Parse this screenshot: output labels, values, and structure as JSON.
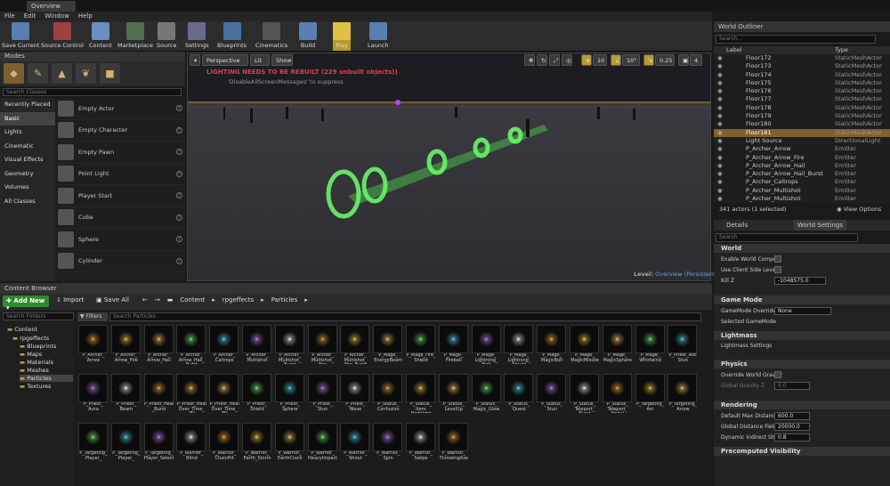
{
  "titlebar": {
    "tab": "Overview"
  },
  "menu": [
    "File",
    "Edit",
    "Window",
    "Help"
  ],
  "toolbar": [
    {
      "label": "Save Current",
      "color": "#5a7fb0"
    },
    {
      "label": "Source Control",
      "color": "#a04040"
    },
    {
      "label": "Content",
      "color": "#6a8fc0"
    },
    {
      "label": "Marketplace",
      "color": "#507050"
    },
    {
      "label": "Source",
      "color": "#777777"
    },
    {
      "label": "Settings",
      "color": "#6a6a8a"
    },
    {
      "label": "Blueprints",
      "color": "#4a6fa0"
    },
    {
      "label": "Cinematics",
      "color": "#555555"
    },
    {
      "label": "Build",
      "color": "#5a7fb0"
    },
    {
      "label": "Play",
      "color": "#e0c040"
    },
    {
      "label": "Launch",
      "color": "#5a7fb0"
    }
  ],
  "modes": {
    "title": "Modes",
    "search_placeholder": "Search Classes",
    "categories": [
      "Recently Placed",
      "Basic",
      "Lights",
      "Cinematic",
      "Visual Effects",
      "Geometry",
      "Volumes",
      "All Classes"
    ],
    "selected_category": "Basic",
    "items": [
      "Empty Actor",
      "Empty Character",
      "Empty Pawn",
      "Point Light",
      "Player Start",
      "Cube",
      "Sphere",
      "Cylinder"
    ]
  },
  "viewport": {
    "perspective": "Perspective",
    "lit": "Lit",
    "show": "Show",
    "grid_snap": "10",
    "rot_snap": "10°",
    "scale_snap": "0.25",
    "cam_speed": "4",
    "warning": "LIGHTING NEEDS TO BE REBUILT (229 unbuilt objects))",
    "suppress": "'DisableAllScreenMessages' to suppress",
    "level_prefix": "Level:",
    "level_name": "Overview (Persistent)"
  },
  "content_browser": {
    "title": "Content Browser",
    "add_new": "Add New",
    "import": "Import",
    "save_all": "Save All",
    "breadcrumb": [
      "Content",
      "rpgeffects",
      "Particles"
    ],
    "folder_search": "Search Folders",
    "filters": "Filters",
    "asset_search": "Search Particles",
    "tree": [
      "Content",
      "rpgeffects",
      "Blueprints",
      "Maps",
      "Materials",
      "Meshes",
      "Particles",
      "Textures"
    ],
    "selected_folder": "Particles",
    "assets": [
      "P_Archer_\nArrow",
      "P_Archer_\nArrow_Fire",
      "P_Archer_\nArrow_Hail",
      "P_Archer_\nArrow_Hail_\nBurst",
      "P_Archer_\nCaltrops",
      "P_Archer_\nMultishot",
      "P_Archer_\nMultishot_\nBurst",
      "P_Archer_\nMultishot_\nFire",
      "P_Archer_\nMultishot_\nFire_Burst",
      "P_Mage_\nEnergyBeam",
      "P_Mage_Fire_\nShield",
      "P_Mage_\nFireball",
      "P_Mage_\nLightning_\nBolt",
      "P_Mage_\nLightning_\nShield",
      "P_Mage_\nMagicBolt",
      "P_Mage_\nMagicMissile",
      "P_Mage_\nMagicSphere",
      "P_Mage_\nWhirlwind",
      "P_Priest_AoE\nStun",
      "P_Priest_\nAura",
      "P_Priest_\nBeam",
      "P_Priest_Heal\n_Burst",
      "P_Priest_Heal\nOver_Time_\n2D",
      "P_Priest_Heal\nOver_Time_\n3D",
      "P_Priest_\nShield",
      "P_Priest_\nSphere",
      "P_Priest_\nStun",
      "P_Priest_\nWave",
      "P_Status_\nConfusion",
      "P_Status_\nItem\nHighlight",
      "P_Status_\nLevelUp",
      "P_Status_\nMagic_Glow",
      "P_Status_\nQuest",
      "P_Status_\nStun",
      "P_Status_\nTeleport_\nBurst",
      "P_Status_\nTeleport_\nPortal",
      "P_Targeting_\nArc",
      "P_Targeting_\nArrow",
      "P_Targeting_\nPlayer_",
      "P_Targeting_\nPlayer_",
      "P_Targeting_\nPlayer_Select",
      "P_Warrior_\nBlind",
      "P_Warrior_\nChainHit",
      "P_Warrior_\nEarth_Storm",
      "P_Warrior_\nEarthCrack",
      "P_Warrior_\nHeavyImpact",
      "P_Warrior_\nShout",
      "P_Warrior_\nSpin",
      "P_Warrior_\nSwipe",
      "P_Warrior_\nThrowingAxe"
    ]
  },
  "outliner": {
    "title": "World Outliner",
    "search_placeholder": "Search...",
    "col_label": "Label",
    "col_type": "Type",
    "rows": [
      {
        "label": "Floor172",
        "type": "StaticMeshActor"
      },
      {
        "label": "Floor173",
        "type": "StaticMeshActor"
      },
      {
        "label": "Floor174",
        "type": "StaticMeshActor"
      },
      {
        "label": "Floor175",
        "type": "StaticMeshActor"
      },
      {
        "label": "Floor176",
        "type": "StaticMeshActor"
      },
      {
        "label": "Floor177",
        "type": "StaticMeshActor"
      },
      {
        "label": "Floor178",
        "type": "StaticMeshActor"
      },
      {
        "label": "Floor179",
        "type": "StaticMeshActor"
      },
      {
        "label": "Floor180",
        "type": "StaticMeshActor"
      },
      {
        "label": "Floor181",
        "type": "StaticMeshActor"
      },
      {
        "label": "Light Source",
        "type": "DirectionalLight"
      },
      {
        "label": "P_Archer_Arrow",
        "type": "Emitter"
      },
      {
        "label": "P_Archer_Arrow_Fire",
        "type": "Emitter"
      },
      {
        "label": "P_Archer_Arrow_Hail",
        "type": "Emitter"
      },
      {
        "label": "P_Archer_Arrow_Hail_Burst",
        "type": "Emitter"
      },
      {
        "label": "P_Archer_Caltrops",
        "type": "Emitter"
      },
      {
        "label": "P_Archer_Multishot",
        "type": "Emitter"
      },
      {
        "label": "P_Archer_Multishot",
        "type": "Emitter"
      }
    ],
    "selected": "Floor181",
    "count": "341 actors (1 selected)",
    "view_options": "View Options"
  },
  "details": {
    "tab_details": "Details",
    "tab_world": "World Settings",
    "search_placeholder": "Search",
    "sec_world": "World",
    "enable_world": "Enable World Composi",
    "client_side": "Use Client Side Level",
    "kill_z": "Kill Z",
    "kill_z_val": "-1048575.0",
    "sec_gamemode": "Game Mode",
    "gm_override": "GameMode Override",
    "gm_val": "None",
    "sel_gm": "Selected GameMode",
    "sec_lightmass": "Lightmass",
    "lm_settings": "Lightmass Settings",
    "sec_physics": "Physics",
    "override_grav": "Override World Gravity",
    "global_grav": "Global Gravity Z",
    "global_grav_val": "0.0",
    "sec_render": "Rendering",
    "def_max": "Default Max Distance",
    "def_max_val": "600.0",
    "global_dist": "Global Distance Field V",
    "global_dist_val": "20000.0",
    "dyn_indirect": "Dynamic Indirect Shad",
    "dyn_indirect_val": "0.8",
    "sec_precomp": "Precomputed Visibility"
  }
}
